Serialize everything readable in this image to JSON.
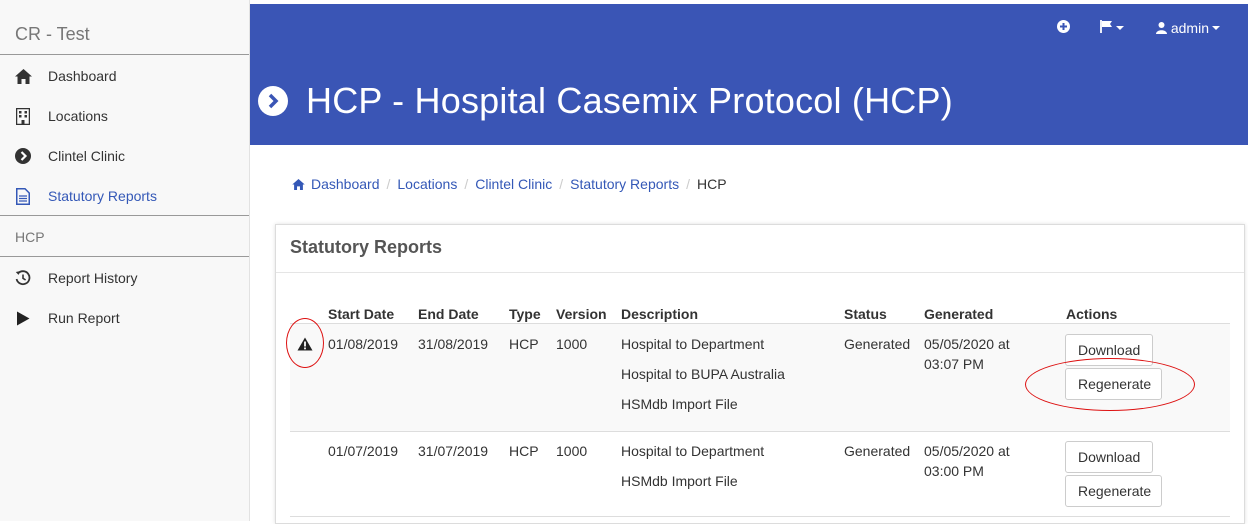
{
  "sidebar": {
    "brand": "CR - Test",
    "items": [
      {
        "label": "Dashboard",
        "icon": "home-icon"
      },
      {
        "label": "Locations",
        "icon": "building-icon"
      },
      {
        "label": "Clintel Clinic",
        "icon": "chevron-circle-icon"
      },
      {
        "label": "Statutory Reports",
        "icon": "file-text-icon"
      }
    ],
    "section_label": "HCP",
    "section_items": [
      {
        "label": "Report History",
        "icon": "history-icon"
      },
      {
        "label": "Run Report",
        "icon": "play-icon"
      }
    ]
  },
  "topnav": {
    "add_icon": "plus-circle-icon",
    "flag_icon": "flag-icon",
    "user_icon": "user-icon",
    "user_label": "admin"
  },
  "page": {
    "title": "HCP - Hospital Casemix Protocol (HCP)"
  },
  "breadcrumb": {
    "items": [
      "Dashboard",
      "Locations",
      "Clintel Clinic",
      "Statutory Reports"
    ],
    "current": "HCP"
  },
  "panel": {
    "title": "Statutory Reports",
    "columns": [
      "Start Date",
      "End Date",
      "Type",
      "Version",
      "Description",
      "Status",
      "Generated",
      "Actions"
    ],
    "rows": [
      {
        "warning": true,
        "start_date": "01/08/2019",
        "end_date": "31/08/2019",
        "type": "HCP",
        "version": "1000",
        "descriptions": [
          "Hospital to Department",
          "Hospital to BUPA Australia",
          "HSMdb Import File"
        ],
        "status": "Generated",
        "generated": [
          "05/05/2020 at",
          "03:07 PM"
        ],
        "download_label": "Download",
        "regenerate_label": "Regenerate"
      },
      {
        "warning": false,
        "start_date": "01/07/2019",
        "end_date": "31/07/2019",
        "type": "HCP",
        "version": "1000",
        "descriptions": [
          "Hospital to Department",
          "HSMdb Import File"
        ],
        "status": "Generated",
        "generated": [
          "05/05/2020 at",
          "03:00 PM"
        ],
        "download_label": "Download",
        "regenerate_label": "Regenerate"
      }
    ]
  },
  "colors": {
    "header_bg": "#3a55b5",
    "link": "#3458b7",
    "annotation": "#dd1111"
  }
}
